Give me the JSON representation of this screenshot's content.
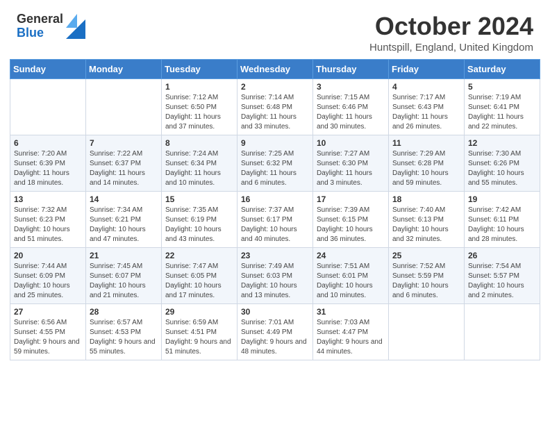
{
  "header": {
    "logo_general": "General",
    "logo_blue": "Blue",
    "month_title": "October 2024",
    "location": "Huntspill, England, United Kingdom"
  },
  "days_of_week": [
    "Sunday",
    "Monday",
    "Tuesday",
    "Wednesday",
    "Thursday",
    "Friday",
    "Saturday"
  ],
  "weeks": [
    [
      {
        "day": "",
        "info": ""
      },
      {
        "day": "",
        "info": ""
      },
      {
        "day": "1",
        "info": "Sunrise: 7:12 AM\nSunset: 6:50 PM\nDaylight: 11 hours and 37 minutes."
      },
      {
        "day": "2",
        "info": "Sunrise: 7:14 AM\nSunset: 6:48 PM\nDaylight: 11 hours and 33 minutes."
      },
      {
        "day": "3",
        "info": "Sunrise: 7:15 AM\nSunset: 6:46 PM\nDaylight: 11 hours and 30 minutes."
      },
      {
        "day": "4",
        "info": "Sunrise: 7:17 AM\nSunset: 6:43 PM\nDaylight: 11 hours and 26 minutes."
      },
      {
        "day": "5",
        "info": "Sunrise: 7:19 AM\nSunset: 6:41 PM\nDaylight: 11 hours and 22 minutes."
      }
    ],
    [
      {
        "day": "6",
        "info": "Sunrise: 7:20 AM\nSunset: 6:39 PM\nDaylight: 11 hours and 18 minutes."
      },
      {
        "day": "7",
        "info": "Sunrise: 7:22 AM\nSunset: 6:37 PM\nDaylight: 11 hours and 14 minutes."
      },
      {
        "day": "8",
        "info": "Sunrise: 7:24 AM\nSunset: 6:34 PM\nDaylight: 11 hours and 10 minutes."
      },
      {
        "day": "9",
        "info": "Sunrise: 7:25 AM\nSunset: 6:32 PM\nDaylight: 11 hours and 6 minutes."
      },
      {
        "day": "10",
        "info": "Sunrise: 7:27 AM\nSunset: 6:30 PM\nDaylight: 11 hours and 3 minutes."
      },
      {
        "day": "11",
        "info": "Sunrise: 7:29 AM\nSunset: 6:28 PM\nDaylight: 10 hours and 59 minutes."
      },
      {
        "day": "12",
        "info": "Sunrise: 7:30 AM\nSunset: 6:26 PM\nDaylight: 10 hours and 55 minutes."
      }
    ],
    [
      {
        "day": "13",
        "info": "Sunrise: 7:32 AM\nSunset: 6:23 PM\nDaylight: 10 hours and 51 minutes."
      },
      {
        "day": "14",
        "info": "Sunrise: 7:34 AM\nSunset: 6:21 PM\nDaylight: 10 hours and 47 minutes."
      },
      {
        "day": "15",
        "info": "Sunrise: 7:35 AM\nSunset: 6:19 PM\nDaylight: 10 hours and 43 minutes."
      },
      {
        "day": "16",
        "info": "Sunrise: 7:37 AM\nSunset: 6:17 PM\nDaylight: 10 hours and 40 minutes."
      },
      {
        "day": "17",
        "info": "Sunrise: 7:39 AM\nSunset: 6:15 PM\nDaylight: 10 hours and 36 minutes."
      },
      {
        "day": "18",
        "info": "Sunrise: 7:40 AM\nSunset: 6:13 PM\nDaylight: 10 hours and 32 minutes."
      },
      {
        "day": "19",
        "info": "Sunrise: 7:42 AM\nSunset: 6:11 PM\nDaylight: 10 hours and 28 minutes."
      }
    ],
    [
      {
        "day": "20",
        "info": "Sunrise: 7:44 AM\nSunset: 6:09 PM\nDaylight: 10 hours and 25 minutes."
      },
      {
        "day": "21",
        "info": "Sunrise: 7:45 AM\nSunset: 6:07 PM\nDaylight: 10 hours and 21 minutes."
      },
      {
        "day": "22",
        "info": "Sunrise: 7:47 AM\nSunset: 6:05 PM\nDaylight: 10 hours and 17 minutes."
      },
      {
        "day": "23",
        "info": "Sunrise: 7:49 AM\nSunset: 6:03 PM\nDaylight: 10 hours and 13 minutes."
      },
      {
        "day": "24",
        "info": "Sunrise: 7:51 AM\nSunset: 6:01 PM\nDaylight: 10 hours and 10 minutes."
      },
      {
        "day": "25",
        "info": "Sunrise: 7:52 AM\nSunset: 5:59 PM\nDaylight: 10 hours and 6 minutes."
      },
      {
        "day": "26",
        "info": "Sunrise: 7:54 AM\nSunset: 5:57 PM\nDaylight: 10 hours and 2 minutes."
      }
    ],
    [
      {
        "day": "27",
        "info": "Sunrise: 6:56 AM\nSunset: 4:55 PM\nDaylight: 9 hours and 59 minutes."
      },
      {
        "day": "28",
        "info": "Sunrise: 6:57 AM\nSunset: 4:53 PM\nDaylight: 9 hours and 55 minutes."
      },
      {
        "day": "29",
        "info": "Sunrise: 6:59 AM\nSunset: 4:51 PM\nDaylight: 9 hours and 51 minutes."
      },
      {
        "day": "30",
        "info": "Sunrise: 7:01 AM\nSunset: 4:49 PM\nDaylight: 9 hours and 48 minutes."
      },
      {
        "day": "31",
        "info": "Sunrise: 7:03 AM\nSunset: 4:47 PM\nDaylight: 9 hours and 44 minutes."
      },
      {
        "day": "",
        "info": ""
      },
      {
        "day": "",
        "info": ""
      }
    ]
  ]
}
